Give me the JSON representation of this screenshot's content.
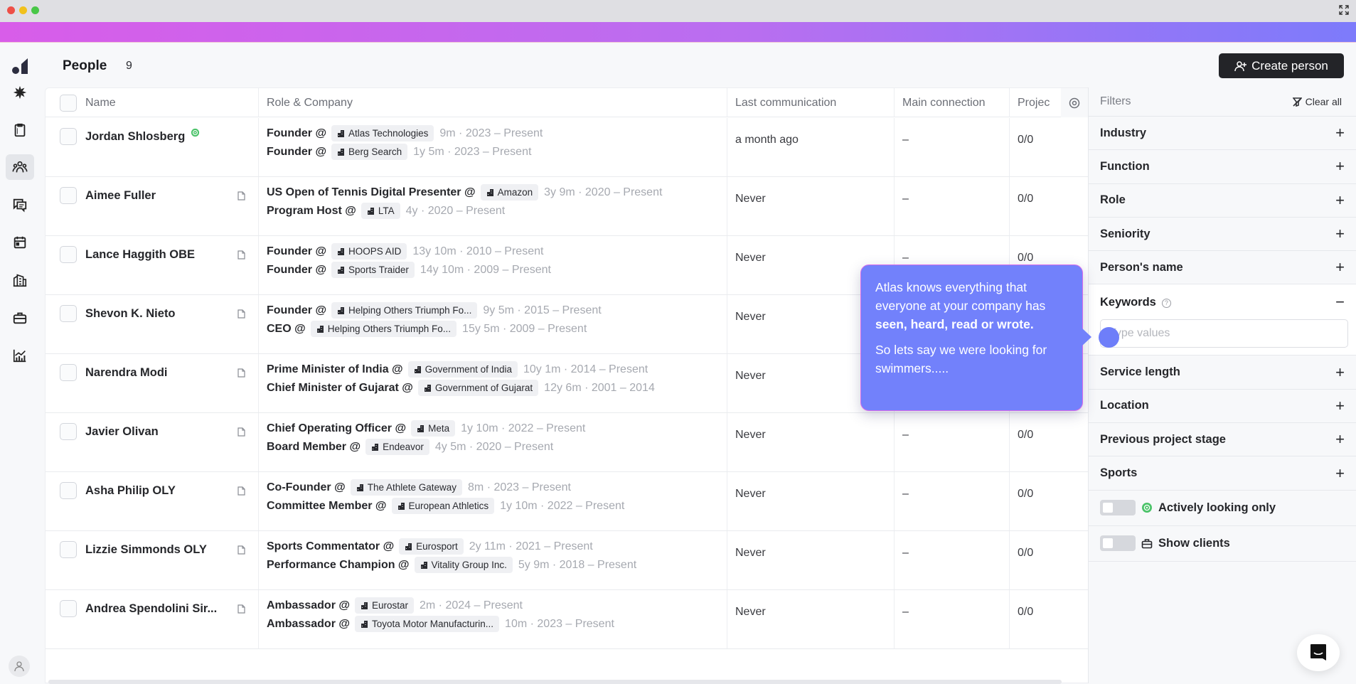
{
  "window": {
    "expand_icon": "expand-icon"
  },
  "sidebar": {
    "items": [
      {
        "name": "dashboard",
        "icon": "spark-icon",
        "active": false
      },
      {
        "name": "projects",
        "icon": "clipboard-icon",
        "active": false
      },
      {
        "name": "people",
        "icon": "people-icon",
        "active": true
      },
      {
        "name": "conversations",
        "icon": "chat-icon",
        "active": false
      },
      {
        "name": "calendar",
        "icon": "calendar-icon",
        "active": false
      },
      {
        "name": "companies",
        "icon": "buildings-icon",
        "active": false
      },
      {
        "name": "jobs",
        "icon": "briefcase-icon",
        "active": false
      },
      {
        "name": "analytics",
        "icon": "chart-icon",
        "active": false
      }
    ]
  },
  "header": {
    "title": "People",
    "count": "9",
    "create_button": "Create person"
  },
  "table": {
    "columns": [
      "Name",
      "Role & Company",
      "Last communication",
      "Main connection",
      "Projec"
    ],
    "rows": [
      {
        "name": "Jordan Shlosberg",
        "active_looking": true,
        "has_doc": false,
        "roles": [
          {
            "title": "Founder @",
            "company": "Atlas Technologies",
            "tenure": "9m · 2023 – Present"
          },
          {
            "title": "Founder @",
            "company": "Berg Search",
            "tenure": "1y 5m · 2023 – Present"
          }
        ],
        "last_communication": "a month ago",
        "main_connection": "–",
        "projects": "0/0"
      },
      {
        "name": "Aimee Fuller",
        "active_looking": false,
        "has_doc": true,
        "roles": [
          {
            "title": "US Open of Tennis Digital Presenter @",
            "company": "Amazon",
            "tenure": "3y 9m · 2020 – Present"
          },
          {
            "title": "Program Host @",
            "company": "LTA",
            "tenure": "4y · 2020 – Present"
          }
        ],
        "last_communication": "Never",
        "main_connection": "–",
        "projects": "0/0"
      },
      {
        "name": "Lance Haggith OBE",
        "active_looking": false,
        "has_doc": true,
        "roles": [
          {
            "title": "Founder @",
            "company": "HOOPS AID",
            "tenure": "13y 10m · 2010 – Present"
          },
          {
            "title": "Founder @",
            "company": "Sports Traider",
            "tenure": "14y 10m · 2009 – Present"
          }
        ],
        "last_communication": "Never",
        "main_connection": "–",
        "projects": "0/0"
      },
      {
        "name": "Shevon K. Nieto",
        "active_looking": false,
        "has_doc": true,
        "roles": [
          {
            "title": "Founder @",
            "company": "Helping Others Triumph Fo...",
            "tenure": "9y 5m · 2015 – Present"
          },
          {
            "title": "CEO @",
            "company": "Helping Others Triumph Fo...",
            "tenure": "15y 5m · 2009 – Present"
          }
        ],
        "last_communication": "Never",
        "main_connection": "–",
        "projects": "0/0"
      },
      {
        "name": "Narendra Modi",
        "active_looking": false,
        "has_doc": true,
        "roles": [
          {
            "title": "Prime Minister of India @",
            "company": "Government of India",
            "tenure": "10y 1m · 2014 – Present"
          },
          {
            "title": "Chief Minister of Gujarat @",
            "company": "Government of Gujarat",
            "tenure": "12y 6m · 2001 – 2014"
          }
        ],
        "last_communication": "Never",
        "main_connection": "–",
        "projects": "0/0"
      },
      {
        "name": "Javier Olivan",
        "active_looking": false,
        "has_doc": true,
        "roles": [
          {
            "title": "Chief Operating Officer @",
            "company": "Meta",
            "tenure": "1y 10m · 2022 – Present"
          },
          {
            "title": "Board Member @",
            "company": "Endeavor",
            "tenure": "4y 5m · 2020 – Present"
          }
        ],
        "last_communication": "Never",
        "main_connection": "–",
        "projects": "0/0"
      },
      {
        "name": "Asha Philip OLY",
        "active_looking": false,
        "has_doc": true,
        "roles": [
          {
            "title": "Co-Founder @",
            "company": "The Athlete Gateway",
            "tenure": "8m · 2023 – Present"
          },
          {
            "title": "Committee Member @",
            "company": "European Athletics",
            "tenure": "1y 10m · 2022 – Present"
          }
        ],
        "last_communication": "Never",
        "main_connection": "–",
        "projects": "0/0"
      },
      {
        "name": "Lizzie Simmonds OLY",
        "active_looking": false,
        "has_doc": true,
        "roles": [
          {
            "title": "Sports Commentator @",
            "company": "Eurosport",
            "tenure": "2y 11m · 2021 – Present"
          },
          {
            "title": "Performance Champion @",
            "company": "Vitality Group Inc.",
            "tenure": "5y 9m · 2018 – Present"
          }
        ],
        "last_communication": "Never",
        "main_connection": "–",
        "projects": "0/0"
      },
      {
        "name": "Andrea Spendolini Sir...",
        "active_looking": false,
        "has_doc": true,
        "roles": [
          {
            "title": "Ambassador @",
            "company": "Eurostar",
            "tenure": "2m · 2024 – Present"
          },
          {
            "title": "Ambassador @",
            "company": "Toyota Motor Manufacturin...",
            "tenure": "10m · 2023 – Present"
          }
        ],
        "last_communication": "Never",
        "main_connection": "–",
        "projects": "0/0"
      }
    ]
  },
  "filters": {
    "title": "Filters",
    "clear_all": "Clear all",
    "items_before": [
      "Industry",
      "Function",
      "Role",
      "Seniority",
      "Person's name"
    ],
    "keywords": {
      "label": "Keywords",
      "placeholder": "Type values",
      "value": ""
    },
    "items_after": [
      "Service length",
      "Location",
      "Previous project stage",
      "Sports"
    ],
    "toggles": [
      {
        "label": "Actively looking only",
        "icon": "signal-icon",
        "on": false
      },
      {
        "label": "Show clients",
        "icon": "briefcase-icon",
        "on": false
      }
    ]
  },
  "tooltip": {
    "line1": "Atlas knows everything that everyone at your company has ",
    "line1_bold": "seen,  heard, read or wrote.",
    "line2": "So lets say we were looking for swimmers....."
  },
  "colors": {
    "accent": "#7281fb",
    "gradient_start": "#d85de9",
    "gradient_end": "#7d7bfb",
    "active_green": "#4cc36a",
    "primary_button": "#232428"
  }
}
